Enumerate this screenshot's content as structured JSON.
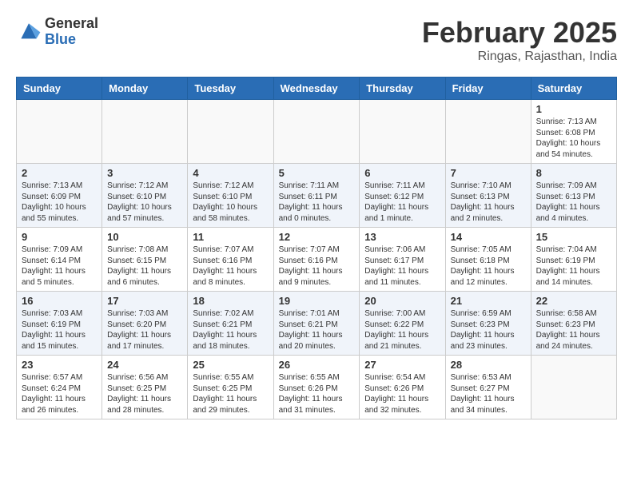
{
  "header": {
    "logo_general": "General",
    "logo_blue": "Blue",
    "month_title": "February 2025",
    "location": "Ringas, Rajasthan, India"
  },
  "weekdays": [
    "Sunday",
    "Monday",
    "Tuesday",
    "Wednesday",
    "Thursday",
    "Friday",
    "Saturday"
  ],
  "weeks": [
    [
      {
        "day": "",
        "info": ""
      },
      {
        "day": "",
        "info": ""
      },
      {
        "day": "",
        "info": ""
      },
      {
        "day": "",
        "info": ""
      },
      {
        "day": "",
        "info": ""
      },
      {
        "day": "",
        "info": ""
      },
      {
        "day": "1",
        "info": "Sunrise: 7:13 AM\nSunset: 6:08 PM\nDaylight: 10 hours\nand 54 minutes."
      }
    ],
    [
      {
        "day": "2",
        "info": "Sunrise: 7:13 AM\nSunset: 6:09 PM\nDaylight: 10 hours\nand 55 minutes."
      },
      {
        "day": "3",
        "info": "Sunrise: 7:12 AM\nSunset: 6:10 PM\nDaylight: 10 hours\nand 57 minutes."
      },
      {
        "day": "4",
        "info": "Sunrise: 7:12 AM\nSunset: 6:10 PM\nDaylight: 10 hours\nand 58 minutes."
      },
      {
        "day": "5",
        "info": "Sunrise: 7:11 AM\nSunset: 6:11 PM\nDaylight: 11 hours\nand 0 minutes."
      },
      {
        "day": "6",
        "info": "Sunrise: 7:11 AM\nSunset: 6:12 PM\nDaylight: 11 hours\nand 1 minute."
      },
      {
        "day": "7",
        "info": "Sunrise: 7:10 AM\nSunset: 6:13 PM\nDaylight: 11 hours\nand 2 minutes."
      },
      {
        "day": "8",
        "info": "Sunrise: 7:09 AM\nSunset: 6:13 PM\nDaylight: 11 hours\nand 4 minutes."
      }
    ],
    [
      {
        "day": "9",
        "info": "Sunrise: 7:09 AM\nSunset: 6:14 PM\nDaylight: 11 hours\nand 5 minutes."
      },
      {
        "day": "10",
        "info": "Sunrise: 7:08 AM\nSunset: 6:15 PM\nDaylight: 11 hours\nand 6 minutes."
      },
      {
        "day": "11",
        "info": "Sunrise: 7:07 AM\nSunset: 6:16 PM\nDaylight: 11 hours\nand 8 minutes."
      },
      {
        "day": "12",
        "info": "Sunrise: 7:07 AM\nSunset: 6:16 PM\nDaylight: 11 hours\nand 9 minutes."
      },
      {
        "day": "13",
        "info": "Sunrise: 7:06 AM\nSunset: 6:17 PM\nDaylight: 11 hours\nand 11 minutes."
      },
      {
        "day": "14",
        "info": "Sunrise: 7:05 AM\nSunset: 6:18 PM\nDaylight: 11 hours\nand 12 minutes."
      },
      {
        "day": "15",
        "info": "Sunrise: 7:04 AM\nSunset: 6:19 PM\nDaylight: 11 hours\nand 14 minutes."
      }
    ],
    [
      {
        "day": "16",
        "info": "Sunrise: 7:03 AM\nSunset: 6:19 PM\nDaylight: 11 hours\nand 15 minutes."
      },
      {
        "day": "17",
        "info": "Sunrise: 7:03 AM\nSunset: 6:20 PM\nDaylight: 11 hours\nand 17 minutes."
      },
      {
        "day": "18",
        "info": "Sunrise: 7:02 AM\nSunset: 6:21 PM\nDaylight: 11 hours\nand 18 minutes."
      },
      {
        "day": "19",
        "info": "Sunrise: 7:01 AM\nSunset: 6:21 PM\nDaylight: 11 hours\nand 20 minutes."
      },
      {
        "day": "20",
        "info": "Sunrise: 7:00 AM\nSunset: 6:22 PM\nDaylight: 11 hours\nand 21 minutes."
      },
      {
        "day": "21",
        "info": "Sunrise: 6:59 AM\nSunset: 6:23 PM\nDaylight: 11 hours\nand 23 minutes."
      },
      {
        "day": "22",
        "info": "Sunrise: 6:58 AM\nSunset: 6:23 PM\nDaylight: 11 hours\nand 24 minutes."
      }
    ],
    [
      {
        "day": "23",
        "info": "Sunrise: 6:57 AM\nSunset: 6:24 PM\nDaylight: 11 hours\nand 26 minutes."
      },
      {
        "day": "24",
        "info": "Sunrise: 6:56 AM\nSunset: 6:25 PM\nDaylight: 11 hours\nand 28 minutes."
      },
      {
        "day": "25",
        "info": "Sunrise: 6:55 AM\nSunset: 6:25 PM\nDaylight: 11 hours\nand 29 minutes."
      },
      {
        "day": "26",
        "info": "Sunrise: 6:55 AM\nSunset: 6:26 PM\nDaylight: 11 hours\nand 31 minutes."
      },
      {
        "day": "27",
        "info": "Sunrise: 6:54 AM\nSunset: 6:26 PM\nDaylight: 11 hours\nand 32 minutes."
      },
      {
        "day": "28",
        "info": "Sunrise: 6:53 AM\nSunset: 6:27 PM\nDaylight: 11 hours\nand 34 minutes."
      },
      {
        "day": "",
        "info": ""
      }
    ]
  ]
}
